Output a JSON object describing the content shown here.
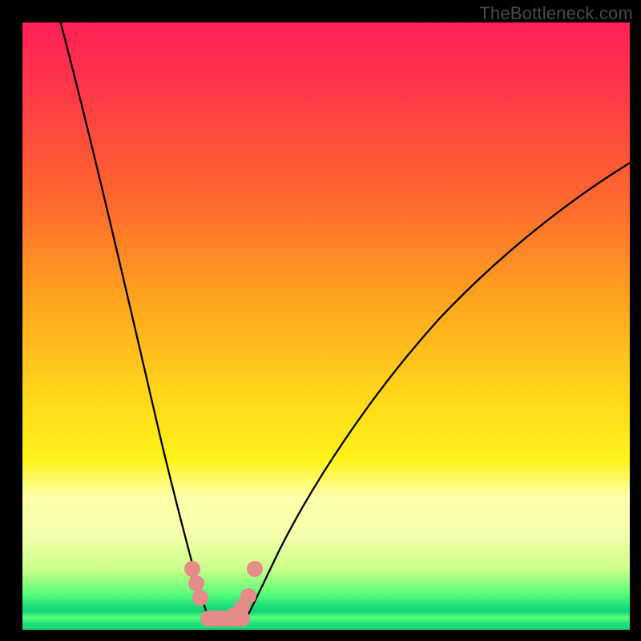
{
  "watermark": "TheBottleneck.com",
  "colors": {
    "background": "#000000",
    "curve": "#000000",
    "marker": "#e58b8a",
    "gradient_top": "#ff1f57",
    "gradient_mid": "#ffd21a",
    "gradient_green": "#12d47a"
  },
  "chart_data": {
    "type": "line",
    "title": "",
    "xlabel": "",
    "ylabel": "",
    "xlim": [
      0,
      100
    ],
    "ylim": [
      0,
      100
    ],
    "annotations": [],
    "series": [
      {
        "name": "left-curve",
        "x": [
          6,
          10,
          14,
          18,
          20,
          22,
          24,
          25.5,
          27,
          28,
          29,
          30.5
        ],
        "values": [
          100,
          82,
          66,
          50,
          42,
          34,
          25,
          18,
          11,
          7,
          4,
          1
        ]
      },
      {
        "name": "right-curve",
        "x": [
          36,
          38,
          42,
          48,
          55,
          63,
          72,
          82,
          92,
          100
        ],
        "values": [
          1,
          4,
          11,
          21,
          32,
          43,
          54,
          64,
          73,
          78
        ]
      },
      {
        "name": "valley-markers",
        "x": [
          27.9,
          28.7,
          29.5,
          30.3,
          31.2,
          32.1,
          33.1,
          34.1,
          35.0,
          35.9,
          37.0
        ],
        "values": [
          9.4,
          6.8,
          4.6,
          2.4,
          1.3,
          1.0,
          1.1,
          1.5,
          2.4,
          4.6,
          9.4
        ]
      }
    ],
    "description": "Black bottleneck curve on a red-to-green vertical gradient. Two curve branches descend from upper-left and upper-right into a narrow valley near x≈32 where salmon-pink round markers sit along the green band at the bottom."
  }
}
